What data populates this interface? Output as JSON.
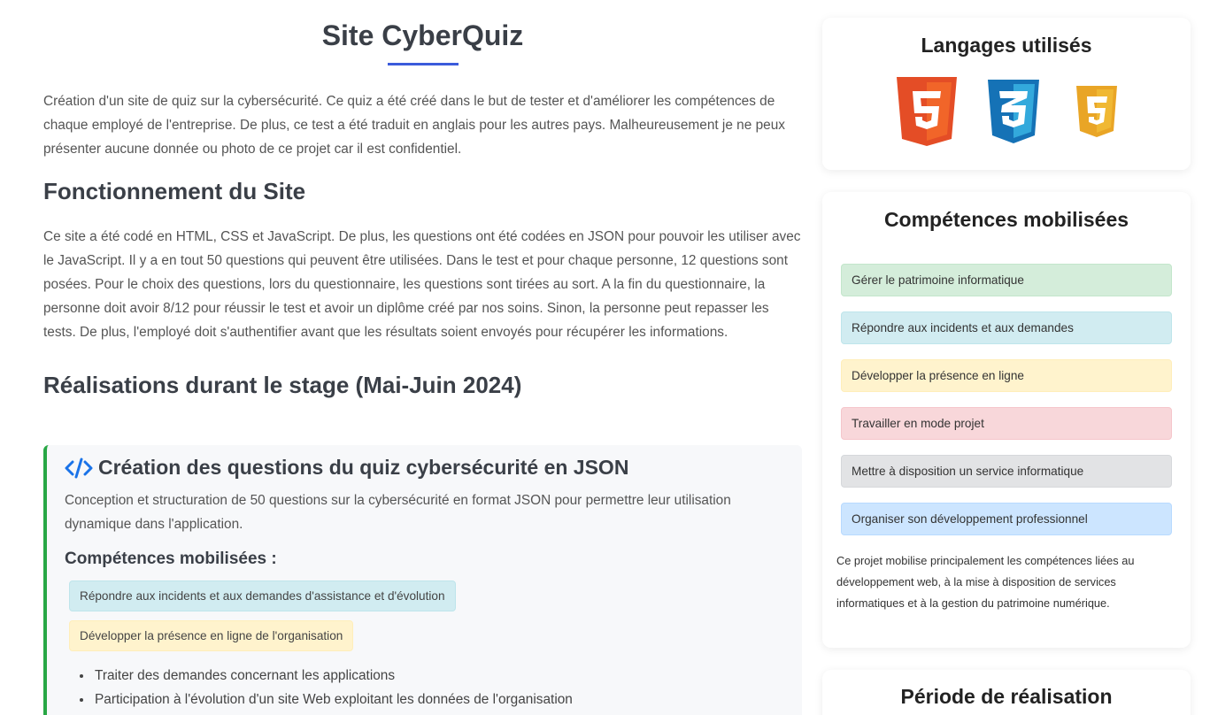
{
  "main": {
    "title": "Site CyberQuiz",
    "intro": "Création d'un site de quiz sur la cybersécurité. Ce quiz a été créé dans le but de tester et d'améliorer les compétences de chaque employé de l'entreprise. De plus, ce test a été traduit en anglais pour les autres pays. Malheureusement je ne peux présenter aucune donnée ou photo de ce projet car il est confidentiel.",
    "section1_title": "Fonctionnement du Site",
    "section1_text": "Ce site a été codé en HTML, CSS et JavaScript. De plus, les questions ont été codées en JSON pour pouvoir les utiliser avec le JavaScript. Il y a en tout 50 questions qui peuvent être utilisées. Dans le test et pour chaque personne, 12 questions sont posées. Pour le choix des questions, lors du questionnaire, les questions sont tirées au sort. A la fin du questionnaire, la personne doit avoir 8/12 pour réussir le test et avoir un diplôme créé par nos soins. Sinon, la personne peut repasser les tests. De plus, l'employé doit s'authentifier avant que les résultats soient envoyés pour récupérer les informations.",
    "section2_title": "Réalisations durant le stage (Mai-Juin 2024)",
    "card": {
      "title": "Création des questions du quiz cybersécurité en JSON",
      "text": "Conception et structuration de 50 questions sur la cybersécurité en format JSON pour permettre leur utilisation dynamique dans l'application.",
      "subtitle": "Compétences mobilisées :",
      "chips": [
        "Répondre aux incidents et aux demandes d'assistance et d'évolution",
        "Développer la présence en ligne de l'organisation"
      ],
      "bullets": [
        "Traiter des demandes concernant les applications",
        "Participation à l'évolution d'un site Web exploitant les données de l'organisation"
      ]
    }
  },
  "sidebar": {
    "languages_title": "Langages utilisés",
    "languages": [
      "html5-icon",
      "css3-icon",
      "javascript-icon"
    ],
    "skills_title": "Compétences mobilisées",
    "skills": [
      {
        "label": "Gérer le patrimoine informatique",
        "color": "#d4edda",
        "border": "#c3e6cb"
      },
      {
        "label": "Répondre aux incidents et aux demandes",
        "color": "#d1ecf1",
        "border": "#bee5eb"
      },
      {
        "label": "Développer la présence en ligne",
        "color": "#fff3cd",
        "border": "#ffeeba"
      },
      {
        "label": "Travailler en mode projet",
        "color": "#f8d7da",
        "border": "#f5c6cb"
      },
      {
        "label": "Mettre à disposition un service informatique",
        "color": "#e2e3e5",
        "border": "#d6d8db"
      },
      {
        "label": "Organiser son développement professionnel",
        "color": "#cce5ff",
        "border": "#b8daff"
      }
    ],
    "skills_note": "Ce projet mobilise principalement les compétences liées au développement web, à la mise à disposition de services informatiques et à la gestion du patrimoine numérique.",
    "period_title": "Période de réalisation"
  },
  "colors": {
    "accent": "#3b5bdb",
    "card_border": "#28a745",
    "html5": "#e44d26",
    "css3": "#1572b6",
    "js": "#e9a526"
  }
}
